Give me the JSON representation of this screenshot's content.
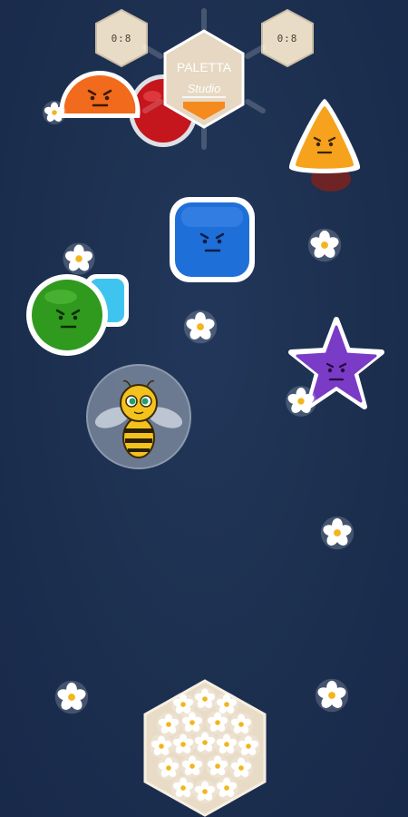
{
  "hud": {
    "left_counter": "0:8",
    "right_counter": "0:8"
  },
  "logo": {
    "line1": "PALETTA",
    "line2": "Studio"
  },
  "player": {
    "icon": "bee-in-bubble-icon"
  },
  "colors": {
    "background": "#1d3050",
    "orange": "#f26a1b",
    "red": "#c4161c",
    "yellow": "#f6a21d",
    "blue": "#1f6fd8",
    "green": "#2f9a1d",
    "purple": "#7a3bc6",
    "hex_badge": "#e9dcc7"
  }
}
